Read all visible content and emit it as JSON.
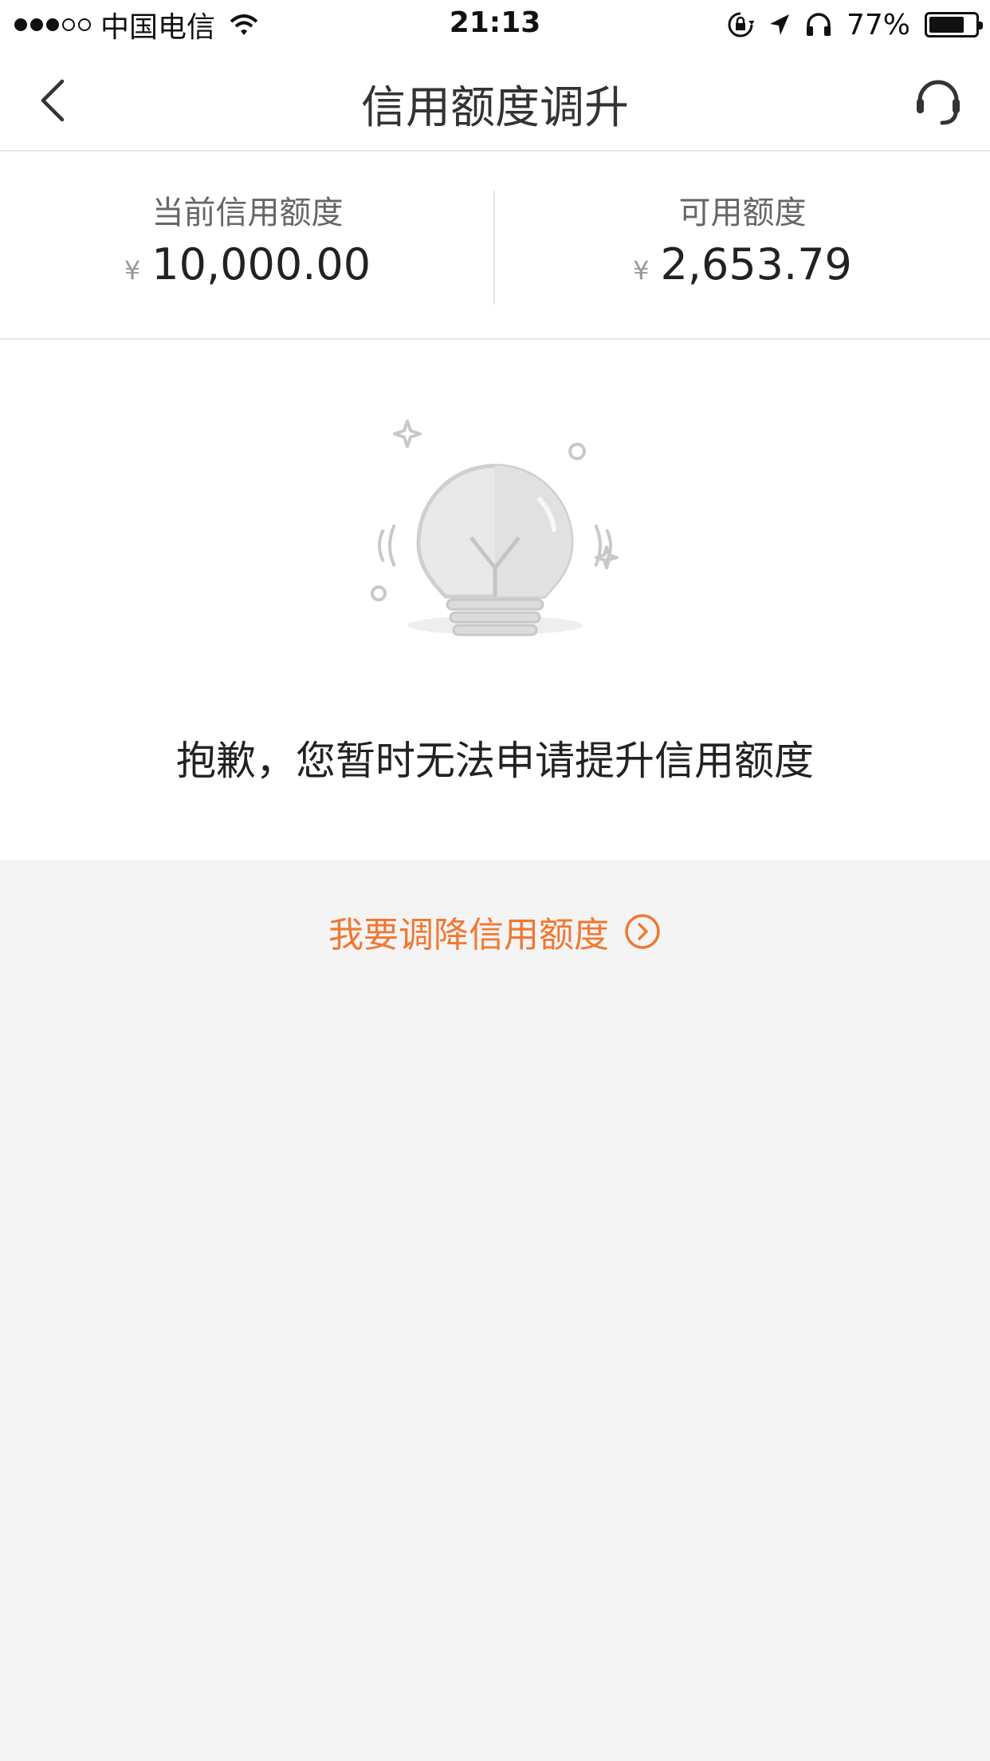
{
  "status_bar": {
    "carrier": "中国电信",
    "time": "21:13",
    "battery": "77%",
    "battery_level": 0.77
  },
  "nav": {
    "title": "信用额度调升"
  },
  "summary": {
    "current_limit_label": "当前信用额度",
    "current_limit_currency": "¥",
    "current_limit_value": "10,000.00",
    "available_label": "可用额度",
    "available_currency": "¥",
    "available_value": "2,653.79"
  },
  "empty_state": {
    "message": "抱歉，您暂时无法申请提升信用额度"
  },
  "action": {
    "decrease_label": "我要调降信用额度"
  },
  "colors": {
    "accent": "#f07832",
    "background": "#f4f4f4",
    "panel": "#ffffff"
  },
  "icons": [
    "back-arrow-icon",
    "customer-service-icon",
    "lightbulb-icon",
    "chevron-right-circle-icon",
    "wifi-icon",
    "lock-rotation-icon",
    "location-arrow-icon",
    "headphones-icon",
    "battery-icon"
  ]
}
